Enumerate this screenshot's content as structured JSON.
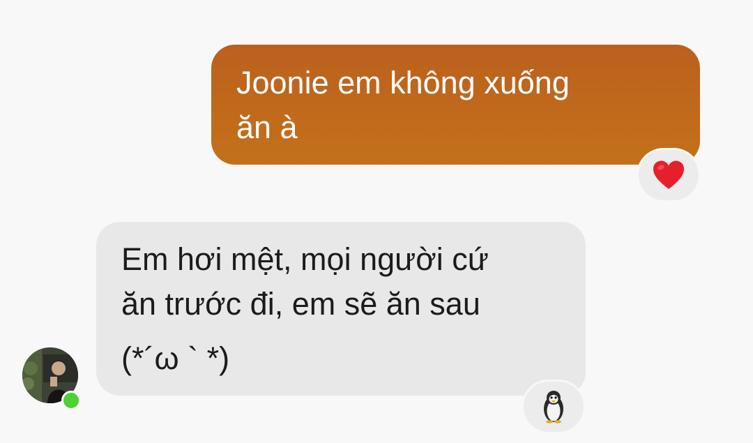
{
  "messages": {
    "sent": {
      "lines": [
        "Joonie em không xuống",
        "ăn à"
      ],
      "reaction": "heart"
    },
    "received": {
      "lines": [
        "Em hơi mệt, mọi người cứ",
        "ăn trước đi, em sẽ ăn sau",
        "(*´ω ` *)"
      ],
      "reaction": "penguin",
      "sender_online": true
    }
  },
  "colors": {
    "sent_bubble": "#bb601e",
    "received_bubble": "#e8e8e8",
    "online_dot": "#4cd137",
    "heart": "#e5202a"
  }
}
